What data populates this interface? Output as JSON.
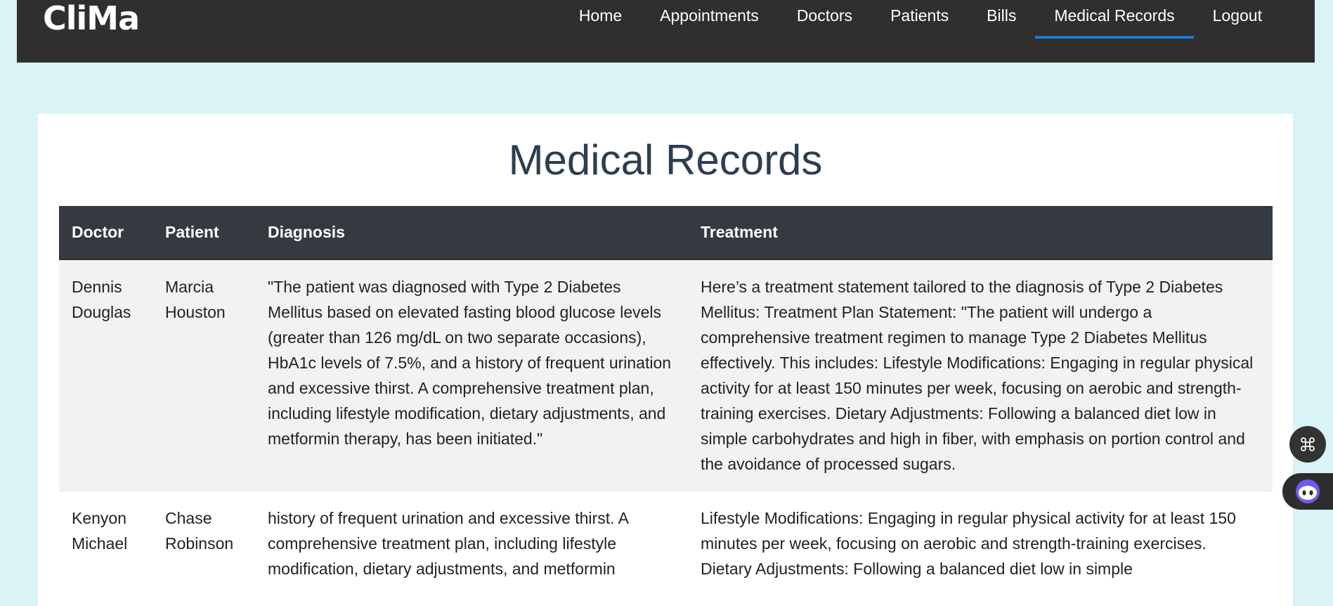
{
  "brand": "CliMa",
  "nav": {
    "items": [
      {
        "label": "Home"
      },
      {
        "label": "Appointments"
      },
      {
        "label": "Doctors"
      },
      {
        "label": "Patients"
      },
      {
        "label": "Bills"
      },
      {
        "label": "Medical Records",
        "active": true
      },
      {
        "label": "Logout"
      }
    ]
  },
  "page": {
    "title": "Medical Records"
  },
  "table": {
    "headers": [
      "Doctor",
      "Patient",
      "Diagnosis",
      "Treatment"
    ],
    "rows": [
      {
        "doctor": "Dennis Douglas",
        "patient": "Marcia Houston",
        "diagnosis": "\"The patient was diagnosed with Type 2 Diabetes Mellitus based on elevated fasting blood glucose levels (greater than 126 mg/dL on two separate occasions), HbA1c levels of 7.5%, and a history of frequent urination and excessive thirst. A comprehensive treatment plan, including lifestyle modification, dietary adjustments, and metformin therapy, has been initiated.\"",
        "treatment": "Here’s a treatment statement tailored to the diagnosis of Type 2 Diabetes Mellitus: Treatment Plan Statement: \"The patient will undergo a comprehensive treatment regimen to manage Type 2 Diabetes Mellitus effectively. This includes: Lifestyle Modifications: Engaging in regular physical activity for at least 150 minutes per week, focusing on aerobic and strength-training exercises. Dietary Adjustments: Following a balanced diet low in simple carbohydrates and high in fiber, with emphasis on portion control and the avoidance of processed sugars."
      },
      {
        "doctor": "Kenyon Michael",
        "patient": "Chase Robinson",
        "diagnosis": "history of frequent urination and excessive thirst. A comprehensive treatment plan, including lifestyle modification, dietary adjustments, and metformin",
        "treatment": "Lifestyle Modifications: Engaging in regular physical activity for at least 150 minutes per week, focusing on aerobic and strength-training exercises. Dietary Adjustments: Following a balanced diet low in simple"
      }
    ]
  },
  "floating": {
    "grid_icon": "command-icon",
    "assistant_icon": "robot-assistant-icon"
  }
}
